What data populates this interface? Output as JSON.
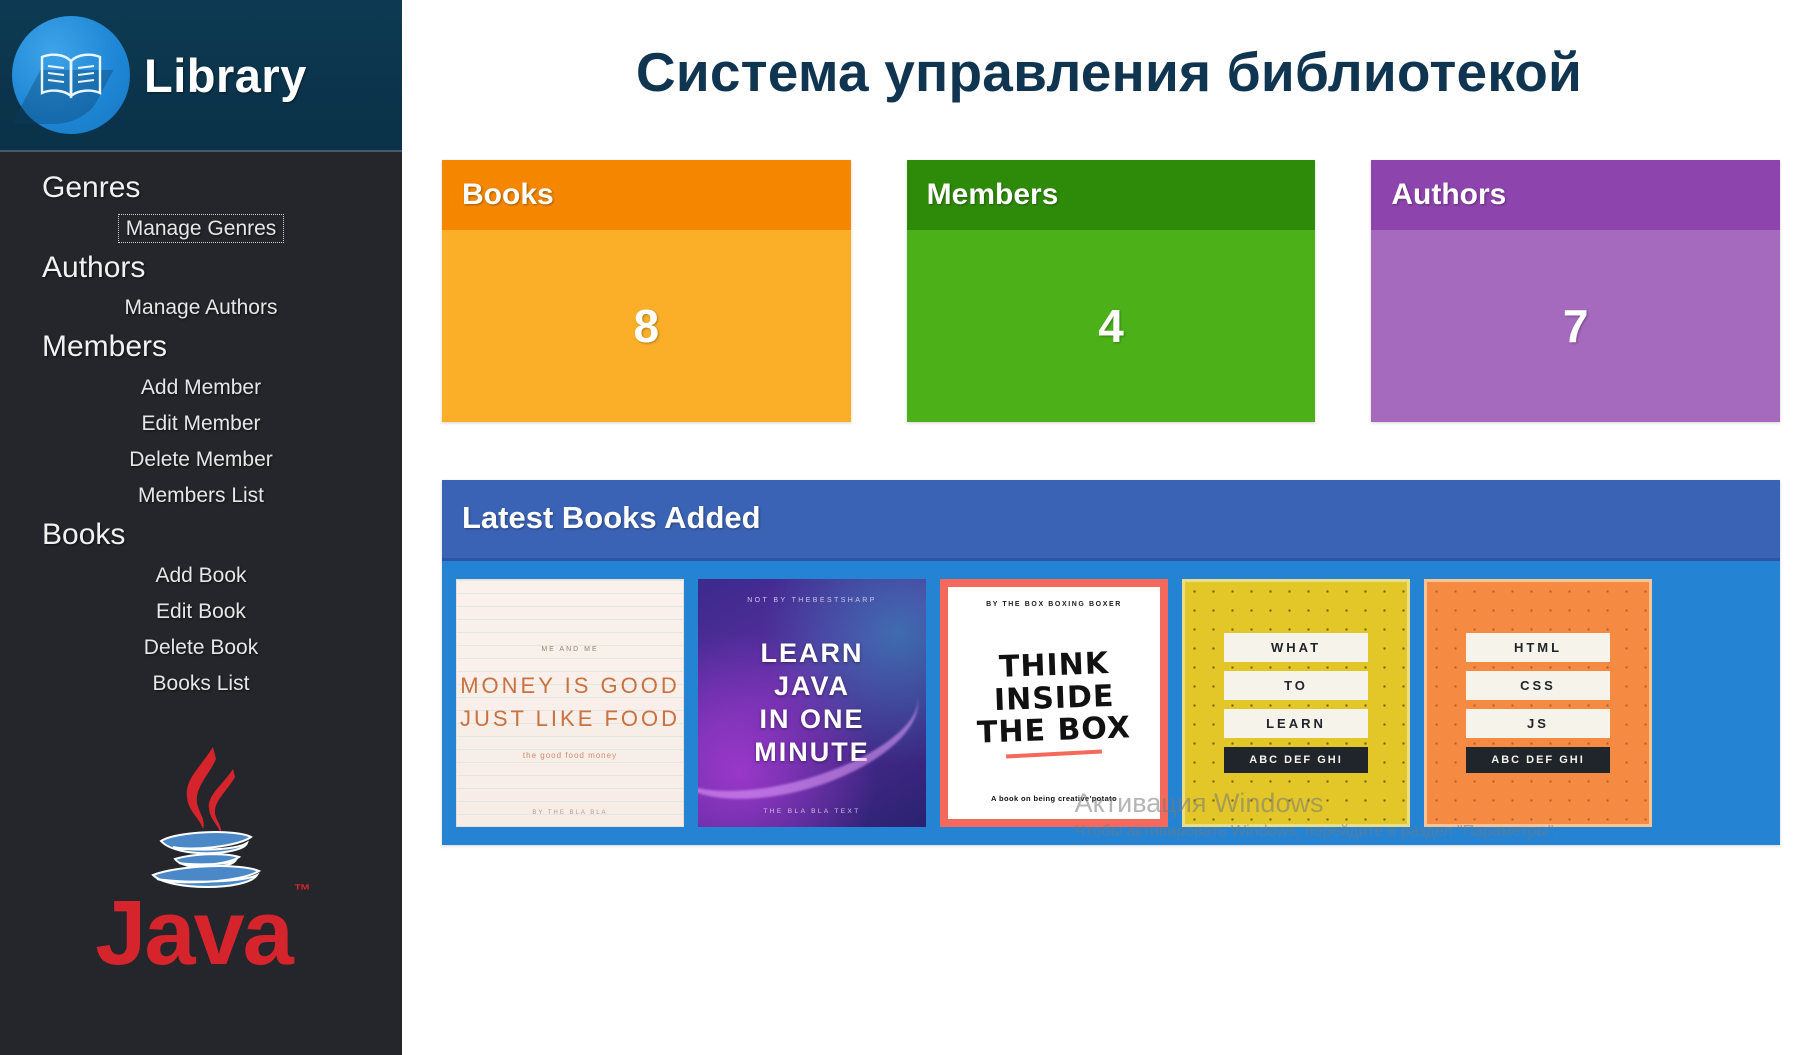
{
  "brand": {
    "title": "Library",
    "logo_icon": "open-book-icon"
  },
  "sidebar": {
    "groups": [
      {
        "title": "Genres",
        "items": [
          {
            "label": "Manage Genres",
            "focused": true
          }
        ]
      },
      {
        "title": "Authors",
        "items": [
          {
            "label": "Manage Authors",
            "focused": false
          }
        ]
      },
      {
        "title": "Members",
        "items": [
          {
            "label": "Add Member",
            "focused": false
          },
          {
            "label": "Edit Member",
            "focused": false
          },
          {
            "label": "Delete Member",
            "focused": false
          },
          {
            "label": "Members List",
            "focused": false
          }
        ]
      },
      {
        "title": "Books",
        "items": [
          {
            "label": "Add Book",
            "focused": false
          },
          {
            "label": "Edit Book",
            "focused": false
          },
          {
            "label": "Delete Book",
            "focused": false
          },
          {
            "label": "Books List",
            "focused": false
          }
        ]
      }
    ],
    "footer_logo": {
      "word": "Java",
      "trademark": "™",
      "icon": "java-coffee-cup-icon"
    }
  },
  "page": {
    "title": "Система управления библиотекой"
  },
  "cards": [
    {
      "label": "Books",
      "value": "8",
      "head_color": "#f58700",
      "body_color": "#fbaf29"
    },
    {
      "label": "Members",
      "value": "4",
      "head_color": "#2e8b09",
      "body_color": "#4cb018"
    },
    {
      "label": "Authors",
      "value": "7",
      "head_color": "#8e44ad",
      "body_color": "#a569bd"
    }
  ],
  "latest": {
    "title": "Latest Books Added",
    "head_color": "#3b63b5",
    "body_color": "#2583d4",
    "books": [
      {
        "kicker": "ME AND ME",
        "title": "MONEY IS GOOD JUST LIKE FOOD",
        "line1": "MONEY IS GOOD",
        "line2": "JUST LIKE FOOD",
        "sub": "the good food money",
        "foot": "BY THE BLA BLA"
      },
      {
        "kicker": "NOT BY THEBESTSHARP",
        "title": "LEARN JAVA IN ONE MINUTE",
        "line1": "LEARN",
        "line2": "JAVA",
        "line3": "IN ONE",
        "line4": "MINUTE",
        "foot": "THE BLA BLA TEXT"
      },
      {
        "kicker": "BY THE BOX BOXING BOXER",
        "title": "THINK INSIDE THE BOX",
        "line1": "THINK",
        "line2": "INSIDE",
        "line3": "THE BOX",
        "foot": "A book on being creative'potato"
      },
      {
        "title": "WHAT TO LEARN",
        "chips": [
          "WHAT",
          "TO",
          "LEARN"
        ],
        "dark_chip": "ABC DEF GHI"
      },
      {
        "title": "HTML CSS JS",
        "chips": [
          "HTML",
          "CSS",
          "JS"
        ],
        "dark_chip": "ABC DEF GHI"
      }
    ]
  },
  "watermark": {
    "line1": "Активация Windows",
    "line2": "Чтобы активировать Windows, перейдите в раздел \"Параметры\"."
  }
}
